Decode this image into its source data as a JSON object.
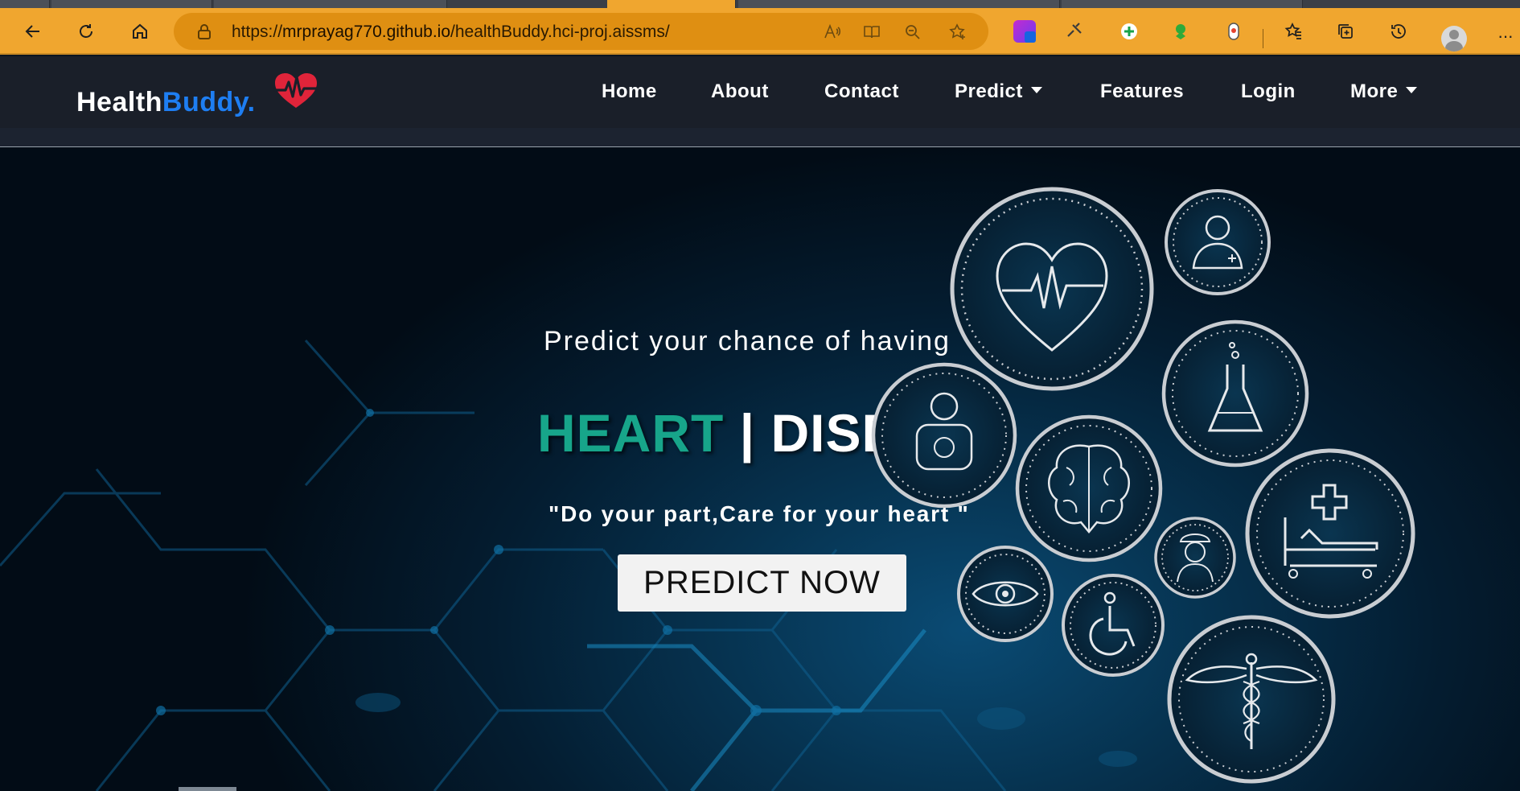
{
  "browser": {
    "url_prefix": "https://",
    "url_host": "mrprayag770.github.io",
    "url_path": "/healthBuddy.hci-proj.aissms/",
    "icons": {
      "back": "back-arrow-icon",
      "refresh": "refresh-icon",
      "home": "home-icon",
      "lock": "lock-icon",
      "read_aloud": "read-aloud-icon",
      "reader": "immersive-reader-icon",
      "zoom": "zoom-out-icon",
      "favorite_add": "add-favorite-icon",
      "favorites": "favorites-icon",
      "collections": "collections-icon",
      "history": "history-icon",
      "profile": "profile-avatar",
      "menu": "more-menu-icon"
    }
  },
  "site": {
    "brand_health": "Health",
    "brand_buddy": "Buddy.",
    "brand_color": "#1e7ef2",
    "nav": {
      "home": "Home",
      "about": "About",
      "contact": "Contact",
      "predict": "Predict",
      "features": "Features",
      "login": "Login",
      "more": "More"
    }
  },
  "hero": {
    "tagline": "Predict your chance of having",
    "headline_heart": "HEART",
    "headline_sep": " | ",
    "headline_disease": "DISEASE",
    "accent_color": "#17a58a",
    "quote": "\"Do your part,Care for your heart \"",
    "cta_label": "PREDICT NOW",
    "medical_icons": [
      "heart-rate-icon",
      "doctor-icon",
      "lab-flask-icon",
      "baby-icon",
      "brain-icon",
      "nurse-icon",
      "hospital-bed-icon",
      "eye-icon",
      "wheelchair-icon",
      "caduceus-icon"
    ]
  }
}
